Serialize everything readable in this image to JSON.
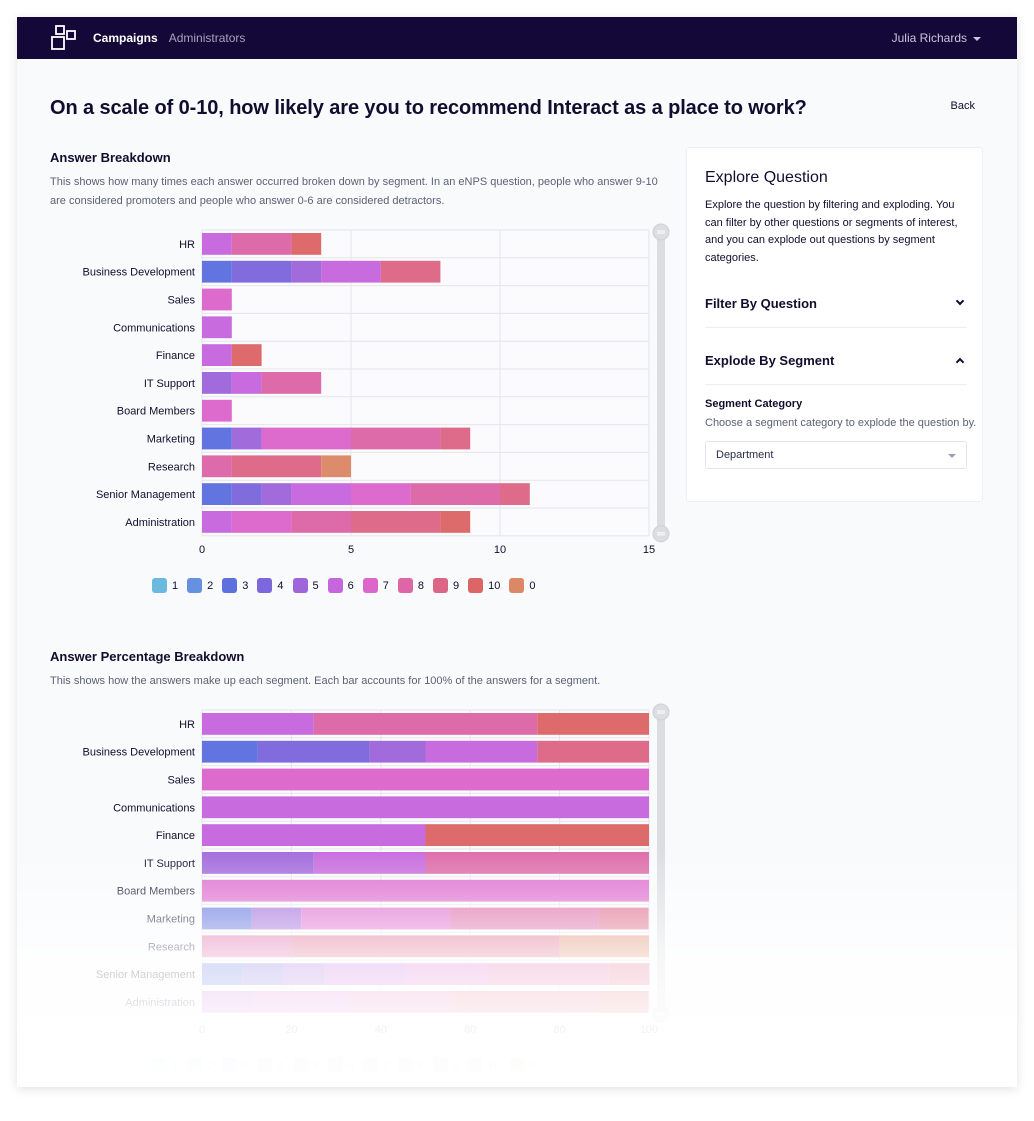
{
  "nav": {
    "logo_icon": "interact-squares-logo",
    "links": [
      {
        "label": "Campaigns",
        "active": true
      },
      {
        "label": "Administrators",
        "active": false
      }
    ],
    "user_name": "Julia Richards",
    "user_caret_icon": "caret-down-icon"
  },
  "page": {
    "title": "On a scale of 0-10, how likely are you to recommend Interact as a place to work?",
    "back_label": "Back"
  },
  "breakdown": {
    "title": "Answer Breakdown",
    "description": "This shows how many times each answer occurred broken down by segment. In an eNPS question, people who answer 9-10 are considered promoters and people who answer 0-6 are considered detractors."
  },
  "percentage": {
    "title": "Answer Percentage Breakdown",
    "description": "This shows how the answers make up each segment. Each bar accounts for 100% of the answers for a segment."
  },
  "explore": {
    "title": "Explore Question",
    "description": "Explore the question by filtering and exploding. You can filter by other questions or segments of interest, and you can explode out questions by segment categories.",
    "filter_label": "Filter By Question",
    "explode_label": "Explode By Segment",
    "segment_category_label": "Segment Category",
    "segment_category_help": "Choose a segment category to explode the question by.",
    "segment_category_value": "Department"
  },
  "chart_data": [
    {
      "type": "bar",
      "orientation": "horizontal",
      "stacked": true,
      "title": "Answer Breakdown",
      "xlabel": "",
      "ylabel": "",
      "xlim": [
        0,
        15
      ],
      "xticks": [
        0,
        5,
        10,
        15
      ],
      "grid": true,
      "legend_position": "bottom",
      "categories": [
        "HR",
        "Business Development",
        "Sales",
        "Communications",
        "Finance",
        "IT Support",
        "Board Members",
        "Marketing",
        "Research",
        "Senior Management",
        "Administration"
      ],
      "series": [
        {
          "name": "1",
          "color": "#6cb9e0",
          "values": [
            0,
            0,
            0,
            0,
            0,
            0,
            0,
            0,
            0,
            0,
            0
          ]
        },
        {
          "name": "2",
          "color": "#6691e0",
          "values": [
            0,
            0,
            0,
            0,
            0,
            0,
            0,
            0,
            0,
            0,
            0
          ]
        },
        {
          "name": "3",
          "color": "#5c70de",
          "values": [
            0,
            1,
            0,
            0,
            0,
            0,
            0,
            1,
            0,
            1,
            0
          ]
        },
        {
          "name": "4",
          "color": "#7d67dc",
          "values": [
            0,
            2,
            0,
            0,
            0,
            0,
            0,
            0,
            0,
            1,
            0
          ]
        },
        {
          "name": "5",
          "color": "#9f66da",
          "values": [
            0,
            1,
            0,
            0,
            0,
            1,
            0,
            1,
            0,
            1,
            0
          ]
        },
        {
          "name": "6",
          "color": "#c566dd",
          "values": [
            1,
            2,
            0,
            1,
            1,
            1,
            0,
            0,
            0,
            2,
            1
          ]
        },
        {
          "name": "7",
          "color": "#dc66cc",
          "values": [
            0,
            0,
            1,
            0,
            0,
            0,
            1,
            3,
            0,
            2,
            2
          ]
        },
        {
          "name": "8",
          "color": "#dc66a6",
          "values": [
            2,
            0,
            0,
            0,
            0,
            2,
            0,
            3,
            1,
            3,
            2
          ]
        },
        {
          "name": "9",
          "color": "#dc6685",
          "values": [
            0,
            2,
            0,
            0,
            0,
            0,
            0,
            1,
            3,
            1,
            3
          ]
        },
        {
          "name": "10",
          "color": "#dc6666",
          "values": [
            1,
            0,
            0,
            0,
            1,
            0,
            0,
            0,
            0,
            0,
            1
          ]
        },
        {
          "name": "0",
          "color": "#dc8866",
          "values": [
            0,
            0,
            0,
            0,
            0,
            0,
            0,
            0,
            1,
            0,
            0
          ]
        }
      ]
    },
    {
      "type": "bar",
      "orientation": "horizontal",
      "stacked": true,
      "normalized_percent": true,
      "title": "Answer Percentage Breakdown",
      "xlabel": "",
      "ylabel": "",
      "xlim": [
        0,
        100
      ],
      "xticks": [
        0,
        20,
        40,
        60,
        80,
        100
      ],
      "grid": true,
      "legend_position": "bottom",
      "categories": [
        "HR",
        "Business Development",
        "Sales",
        "Communications",
        "Finance",
        "IT Support",
        "Board Members",
        "Marketing",
        "Research",
        "Senior Management",
        "Administration"
      ],
      "series": [
        {
          "name": "1",
          "color": "#6cb9e0",
          "values": [
            0,
            0,
            0,
            0,
            0,
            0,
            0,
            0,
            0,
            0,
            0
          ]
        },
        {
          "name": "2",
          "color": "#6691e0",
          "values": [
            0,
            0,
            0,
            0,
            0,
            0,
            0,
            0,
            0,
            0,
            0
          ]
        },
        {
          "name": "3",
          "color": "#5c70de",
          "values": [
            0,
            12.5,
            0,
            0,
            0,
            0,
            0,
            11.1,
            0,
            9.1,
            0
          ]
        },
        {
          "name": "4",
          "color": "#7d67dc",
          "values": [
            0,
            25,
            0,
            0,
            0,
            0,
            0,
            0,
            0,
            9.1,
            0
          ]
        },
        {
          "name": "5",
          "color": "#9f66da",
          "values": [
            0,
            12.5,
            0,
            0,
            0,
            25,
            0,
            11.1,
            0,
            9.1,
            0
          ]
        },
        {
          "name": "6",
          "color": "#c566dd",
          "values": [
            25,
            25,
            0,
            100,
            50,
            25,
            0,
            0,
            0,
            18.2,
            11.1
          ]
        },
        {
          "name": "7",
          "color": "#dc66cc",
          "values": [
            0,
            0,
            100,
            0,
            0,
            0,
            100,
            33.3,
            0,
            18.2,
            22.2
          ]
        },
        {
          "name": "8",
          "color": "#dc66a6",
          "values": [
            50,
            0,
            0,
            0,
            0,
            50,
            0,
            33.3,
            20,
            27.3,
            22.2
          ]
        },
        {
          "name": "9",
          "color": "#dc6685",
          "values": [
            0,
            25,
            0,
            0,
            0,
            0,
            0,
            11.1,
            60,
            9.1,
            33.3
          ]
        },
        {
          "name": "10",
          "color": "#dc6666",
          "values": [
            25,
            0,
            0,
            0,
            50,
            0,
            0,
            0,
            0,
            0,
            11.1
          ]
        },
        {
          "name": "0",
          "color": "#dc8866",
          "values": [
            0,
            0,
            0,
            0,
            0,
            0,
            0,
            0,
            20,
            0,
            0
          ]
        }
      ]
    }
  ]
}
